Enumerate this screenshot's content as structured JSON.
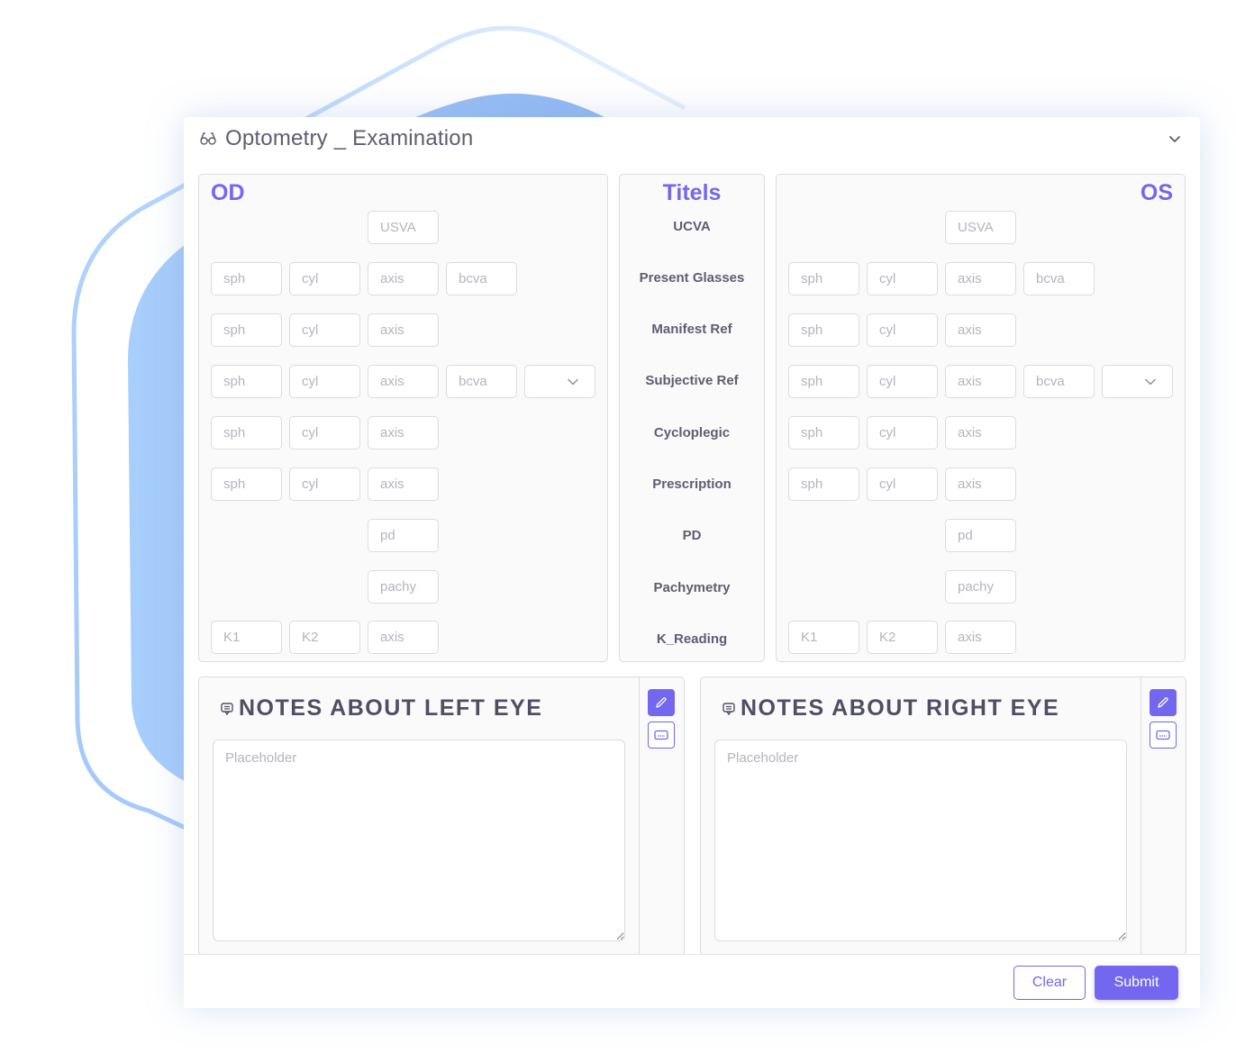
{
  "card": {
    "title": "Optometry _ Examination",
    "title_icon": "glasses-icon",
    "collapse_icon": "chevron-down-icon"
  },
  "od": {
    "heading": "OD",
    "rows": [
      {
        "name": "ucva",
        "fields": [
          {
            "col": 2,
            "placeholder": "USVA"
          }
        ]
      },
      {
        "name": "present-glasses",
        "fields": [
          {
            "col": 0,
            "placeholder": "sph"
          },
          {
            "col": 1,
            "placeholder": "cyl"
          },
          {
            "col": 2,
            "placeholder": "axis"
          },
          {
            "col": 3,
            "placeholder": "bcva"
          }
        ]
      },
      {
        "name": "manifest-ref",
        "fields": [
          {
            "col": 0,
            "placeholder": "sph"
          },
          {
            "col": 1,
            "placeholder": "cyl"
          },
          {
            "col": 2,
            "placeholder": "axis"
          }
        ]
      },
      {
        "name": "subjective-ref",
        "fields": [
          {
            "col": 0,
            "placeholder": "sph"
          },
          {
            "col": 1,
            "placeholder": "cyl"
          },
          {
            "col": 2,
            "placeholder": "axis"
          },
          {
            "col": 3,
            "placeholder": "bcva"
          }
        ],
        "select": {
          "col": 4,
          "value": ""
        }
      },
      {
        "name": "cycloplegic",
        "fields": [
          {
            "col": 0,
            "placeholder": "sph"
          },
          {
            "col": 1,
            "placeholder": "cyl"
          },
          {
            "col": 2,
            "placeholder": "axis"
          }
        ]
      },
      {
        "name": "prescription",
        "fields": [
          {
            "col": 0,
            "placeholder": "sph"
          },
          {
            "col": 1,
            "placeholder": "cyl"
          },
          {
            "col": 2,
            "placeholder": "axis"
          }
        ]
      },
      {
        "name": "pd",
        "fields": [
          {
            "col": 2,
            "placeholder": "pd"
          }
        ]
      },
      {
        "name": "pachymetry",
        "fields": [
          {
            "col": 2,
            "placeholder": "pachy"
          }
        ]
      },
      {
        "name": "k-reading",
        "fields": [
          {
            "col": 0,
            "placeholder": "K1"
          },
          {
            "col": 1,
            "placeholder": "K2"
          },
          {
            "col": 2,
            "placeholder": "axis"
          }
        ]
      }
    ]
  },
  "titels": {
    "heading": "Titels",
    "labels": [
      "UCVA",
      "Present Glasses",
      "Manifest Ref",
      "Subjective Ref",
      "Cycloplegic",
      "Prescription",
      "PD",
      "Pachymetry",
      "K_Reading"
    ]
  },
  "os": {
    "heading": "OS",
    "rows": [
      {
        "name": "ucva",
        "fields": [
          {
            "col": 2,
            "placeholder": "USVA"
          }
        ]
      },
      {
        "name": "present-glasses",
        "fields": [
          {
            "col": 0,
            "placeholder": "sph"
          },
          {
            "col": 1,
            "placeholder": "cyl"
          },
          {
            "col": 2,
            "placeholder": "axis"
          },
          {
            "col": 3,
            "placeholder": "bcva"
          }
        ]
      },
      {
        "name": "manifest-ref",
        "fields": [
          {
            "col": 0,
            "placeholder": "sph"
          },
          {
            "col": 1,
            "placeholder": "cyl"
          },
          {
            "col": 2,
            "placeholder": "axis"
          }
        ]
      },
      {
        "name": "subjective-ref",
        "fields": [
          {
            "col": 0,
            "placeholder": "sph"
          },
          {
            "col": 1,
            "placeholder": "cyl"
          },
          {
            "col": 2,
            "placeholder": "axis"
          },
          {
            "col": 3,
            "placeholder": "bcva"
          }
        ],
        "select": {
          "col": 4,
          "value": ""
        }
      },
      {
        "name": "cycloplegic",
        "fields": [
          {
            "col": 0,
            "placeholder": "sph"
          },
          {
            "col": 1,
            "placeholder": "cyl"
          },
          {
            "col": 2,
            "placeholder": "axis"
          }
        ]
      },
      {
        "name": "prescription",
        "fields": [
          {
            "col": 0,
            "placeholder": "sph"
          },
          {
            "col": 1,
            "placeholder": "cyl"
          },
          {
            "col": 2,
            "placeholder": "axis"
          }
        ]
      },
      {
        "name": "pd",
        "fields": [
          {
            "col": 2,
            "placeholder": "pd"
          }
        ]
      },
      {
        "name": "pachymetry",
        "fields": [
          {
            "col": 2,
            "placeholder": "pachy"
          }
        ]
      },
      {
        "name": "k-reading",
        "fields": [
          {
            "col": 0,
            "placeholder": "K1"
          },
          {
            "col": 1,
            "placeholder": "K2"
          },
          {
            "col": 2,
            "placeholder": "axis"
          }
        ]
      }
    ]
  },
  "notes": {
    "left": {
      "title": "NOTES ABOUT LEFT EYE",
      "placeholder": "Placeholder",
      "value": "",
      "icon": "comment-icon",
      "edit_icon": "pencil-icon",
      "keyboard_icon": "keyboard-icon"
    },
    "right": {
      "title": "NOTES ABOUT RIGHT EYE",
      "placeholder": "Placeholder",
      "value": "",
      "icon": "comment-icon",
      "edit_icon": "pencil-icon",
      "keyboard_icon": "keyboard-icon"
    }
  },
  "footer": {
    "clear_label": "Clear",
    "submit_label": "Submit"
  },
  "colors": {
    "accent": "#7367f0",
    "text": "#5e5d72",
    "border": "#dcdce0",
    "panel_bg": "#fafafa",
    "deco_blue": "#a6ccfb"
  }
}
